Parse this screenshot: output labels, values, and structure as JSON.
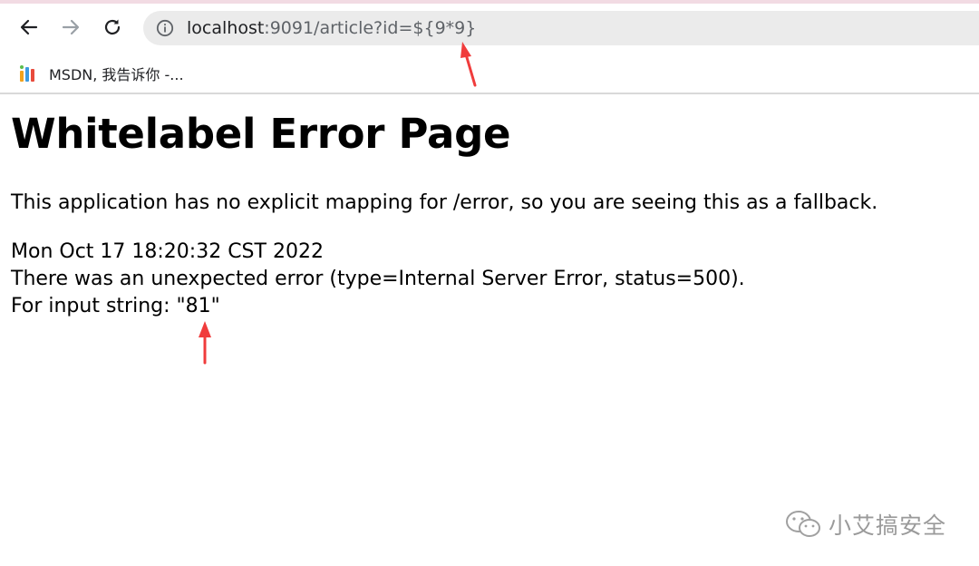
{
  "browser": {
    "url_host": "localhost",
    "url_path": ":9091/article?id=${9*9}",
    "bookmarks": [
      {
        "label": "MSDN, 我告诉你 -..."
      }
    ]
  },
  "page": {
    "title": "Whitelabel Error Page",
    "message": "This application has no explicit mapping for /error, so you are seeing this as a fallback.",
    "timestamp": "Mon Oct 17 18:20:32 CST 2022",
    "error_detail": "There was an unexpected error (type=Internal Server Error, status=500).",
    "exception": "For input string: \"81\""
  },
  "watermark": {
    "label": "小艾搞安全"
  },
  "colors": {
    "annotation_arrow": "#f03c3c",
    "omnibox_bg": "#ebebeb",
    "tab_strip": "#f2dbe3"
  }
}
